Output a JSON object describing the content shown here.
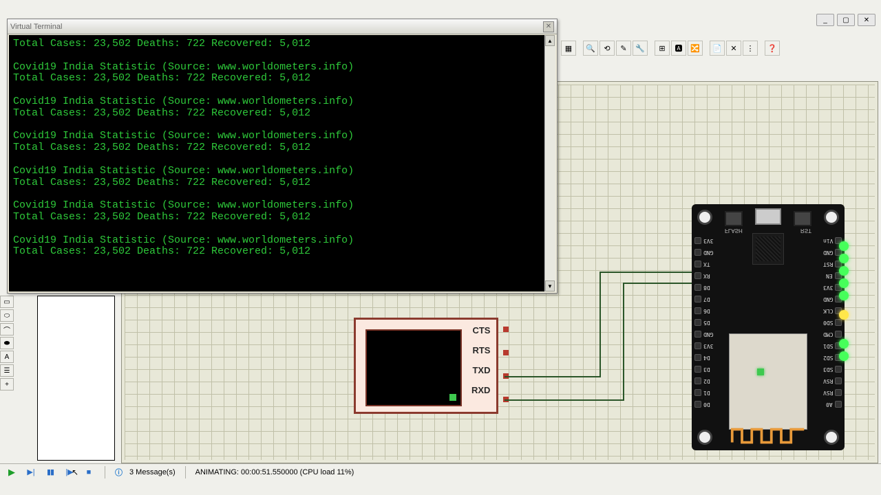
{
  "titlebar": {
    "min": "_",
    "max": "▢",
    "close": "✕"
  },
  "terminal": {
    "title": "Virtual Terminal",
    "close": "✕",
    "lines": [
      "Total Cases: 23,502 Deaths: 722 Recovered: 5,012",
      "",
      "Covid19 India Statistic (Source: www.worldometers.info)",
      "Total Cases: 23,502 Deaths: 722 Recovered: 5,012",
      "",
      "Covid19 India Statistic (Source: www.worldometers.info)",
      "Total Cases: 23,502 Deaths: 722 Recovered: 5,012",
      "",
      "Covid19 India Statistic (Source: www.worldometers.info)",
      "Total Cases: 23,502 Deaths: 722 Recovered: 5,012",
      "",
      "Covid19 India Statistic (Source: www.worldometers.info)",
      "Total Cases: 23,502 Deaths: 722 Recovered: 5,012",
      "",
      "Covid19 India Statistic (Source: www.worldometers.info)",
      "Total Cases: 23,502 Deaths: 722 Recovered: 5,012",
      "",
      "Covid19 India Statistic (Source: www.worldometers.info)",
      "Total Cases: 23,502 Deaths: 722 Recovered: 5,012"
    ]
  },
  "serial": {
    "pins": [
      "CTS",
      "RTS",
      "TXD",
      "RXD"
    ]
  },
  "nodemcu": {
    "btn_flash": "FLASH",
    "btn_rst": "RST",
    "left_pins": [
      "3V3",
      "GND",
      "TX",
      "RX",
      "D8",
      "D7",
      "D6",
      "D5",
      "GND",
      "3V3",
      "D4",
      "D3",
      "D2",
      "D1",
      "D0"
    ],
    "right_pins": [
      "Vin",
      "GND",
      "RST",
      "EN",
      "3V3",
      "GND",
      "CLK",
      "SD0",
      "CMD",
      "SD1",
      "SD2",
      "SD3",
      "RSV",
      "RSV",
      "A0"
    ]
  },
  "status": {
    "messages_count": "3 Message(s)",
    "animating": "ANIMATING: 00:00:51.550000 (CPU load 11%)"
  },
  "toolbar_icons": [
    "▦",
    "🔍",
    "⟲",
    "✎",
    "🔧",
    "",
    "⊞",
    "🅰",
    "🔀",
    "",
    "📄",
    "✕",
    "⋮",
    "",
    "❓"
  ],
  "left_tools": [
    "▭",
    "⬭",
    "⌒",
    "⬬",
    "A",
    "☰",
    "+"
  ]
}
